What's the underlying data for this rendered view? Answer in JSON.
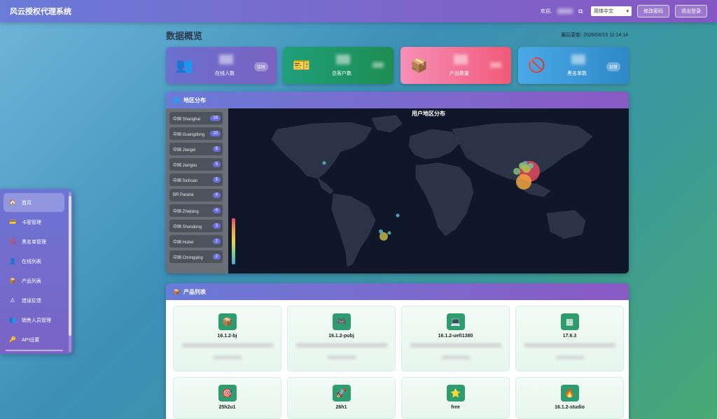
{
  "header": {
    "title": "风云授权代理系统",
    "welcome": "欢迎,",
    "language": "简体中文",
    "change_password": "修改密码",
    "logout": "退出登录"
  },
  "sidebar": {
    "items": [
      {
        "label": "首页",
        "icon": "home-icon",
        "glyph": "🏠"
      },
      {
        "label": "卡密管理",
        "icon": "card-icon",
        "glyph": "💳"
      },
      {
        "label": "黑名单管理",
        "icon": "block-icon",
        "glyph": "🚫"
      },
      {
        "label": "在线列表",
        "icon": "user-icon",
        "glyph": "👤"
      },
      {
        "label": "产品列表",
        "icon": "box-icon",
        "glyph": "📦"
      },
      {
        "label": "错误反馈",
        "icon": "warning-icon",
        "glyph": "⚠"
      },
      {
        "label": "销售人员管理",
        "icon": "people-icon",
        "glyph": "👥"
      },
      {
        "label": "API设置",
        "icon": "key-icon",
        "glyph": "🔑"
      }
    ]
  },
  "page": {
    "title": "数据概览",
    "last_update": "最后更新: 2026/06/15 11:14:14"
  },
  "stats": [
    {
      "label": "在线人数",
      "badge": "实时",
      "icon": "users-icon",
      "glyph": "👥",
      "color": "#6a66c8"
    },
    {
      "label": "总客户数",
      "badge": "",
      "icon": "ticket-icon",
      "glyph": "🎫",
      "color": "#1f9e6a"
    },
    {
      "label": "产品数量",
      "badge": "",
      "icon": "package-icon",
      "glyph": "📦",
      "color": "#f2708f"
    },
    {
      "label": "黑名单数",
      "badge": "封禁",
      "icon": "ban-icon",
      "glyph": "🚫",
      "color": "#3a9be0"
    }
  ],
  "region": {
    "title": "地区分布",
    "map_title": "用户地区分布",
    "items": [
      {
        "name": "中国 Shanghai",
        "count": "19"
      },
      {
        "name": "中国 Guangdong",
        "count": "10"
      },
      {
        "name": "中国 Jiangxi",
        "count": "6"
      },
      {
        "name": "中国 Jiangsu",
        "count": "5"
      },
      {
        "name": "中国 Sichuan",
        "count": "5"
      },
      {
        "name": "BR Paraná",
        "count": "4"
      },
      {
        "name": "中国 Zhejiang",
        "count": "4"
      },
      {
        "name": "中国 Shandong",
        "count": "3"
      },
      {
        "name": "中国 Hubei",
        "count": "2"
      },
      {
        "name": "中国 Chongqing",
        "count": "2"
      }
    ]
  },
  "products": {
    "title": "产品列表",
    "items": [
      {
        "name": "16.1.2-bj",
        "glyph": "📦"
      },
      {
        "name": "16.1.2-pubj",
        "glyph": "🎮"
      },
      {
        "name": "16.1.2-uefi1380",
        "glyph": "💻"
      },
      {
        "name": "17.6.3",
        "glyph": "▦"
      },
      {
        "name": "25h2u1",
        "glyph": "🎯"
      },
      {
        "name": "26h1",
        "glyph": "🚀"
      },
      {
        "name": "free",
        "glyph": "⭐"
      },
      {
        "name": "16.1.2-studio",
        "glyph": "🔥"
      }
    ]
  }
}
